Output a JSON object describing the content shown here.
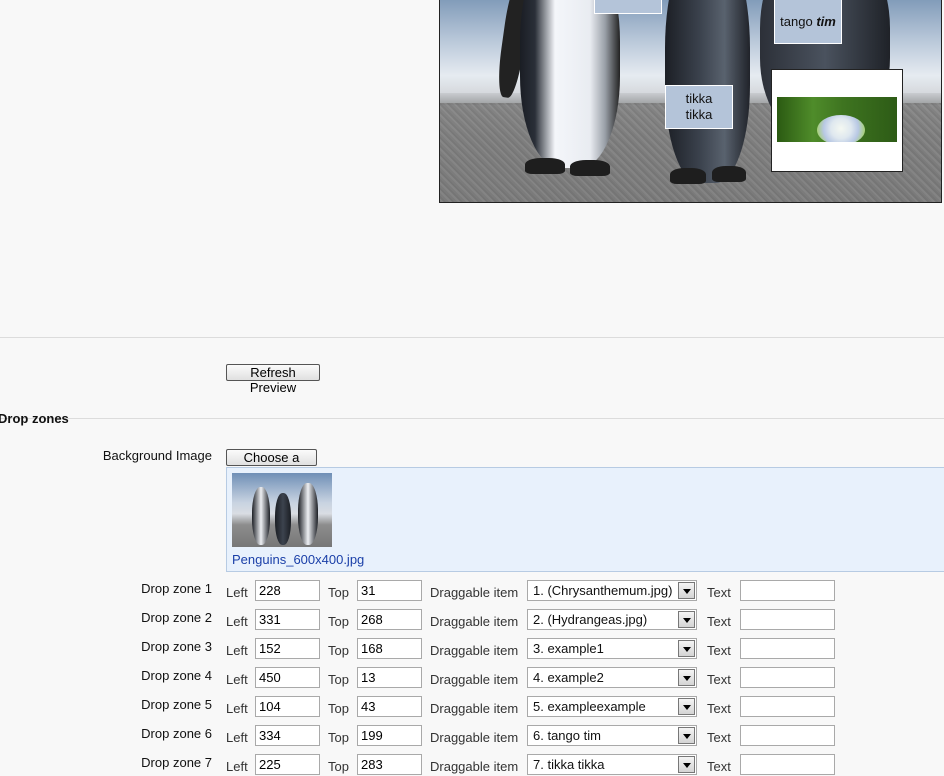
{
  "preview": {
    "dropzone_top_label": "",
    "tango_text": "tango",
    "tango_em": "tim",
    "tikka_line1": "tikka",
    "tikka_line2": "tikka"
  },
  "refresh_button": "Refresh Preview",
  "section_title": "Drop zones",
  "background_image": {
    "label": "Background Image",
    "choose_button": "Choose a file...",
    "file_name": "Penguins_600x400.jpg"
  },
  "field_labels": {
    "left": "Left",
    "top": "Top",
    "draggable_item": "Draggable item",
    "text": "Text"
  },
  "drop_zones": [
    {
      "label": "Drop zone 1",
      "left": "228",
      "top": "31",
      "item": "1. (Chrysanthemum.jpg)",
      "text": ""
    },
    {
      "label": "Drop zone 2",
      "left": "331",
      "top": "268",
      "item": "2. (Hydrangeas.jpg)",
      "text": ""
    },
    {
      "label": "Drop zone 3",
      "left": "152",
      "top": "168",
      "item": "3. example1",
      "text": ""
    },
    {
      "label": "Drop zone 4",
      "left": "450",
      "top": "13",
      "item": "4. example2",
      "text": ""
    },
    {
      "label": "Drop zone 5",
      "left": "104",
      "top": "43",
      "item": "5. exampleexample",
      "text": ""
    },
    {
      "label": "Drop zone 6",
      "left": "334",
      "top": "199",
      "item": "6. tango tim",
      "text": ""
    },
    {
      "label": "Drop zone 7",
      "left": "225",
      "top": "283",
      "item": "7. tikka tikka",
      "text": ""
    }
  ]
}
